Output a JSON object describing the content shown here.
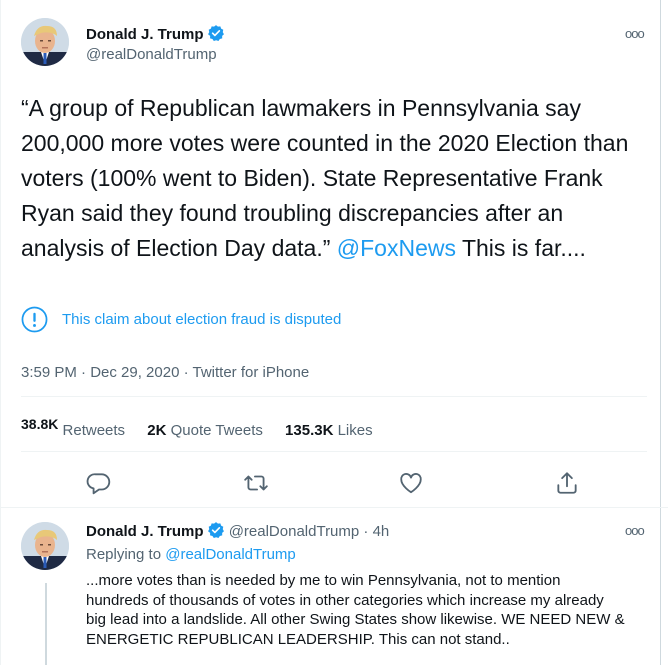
{
  "tweet": {
    "author_name": "Donald J. Trump",
    "author_handle": "@realDonaldTrump",
    "text_before_link": "“A group of Republican lawmakers in Pennsylvania say 200,000 more votes were counted in the 2020 Election than voters (100% went to Biden). State Representative Frank Ryan said they found troubling discrepancies after an analysis of Election Day data.” ",
    "link_text": "@FoxNews",
    "text_after_link": " This is far....",
    "claim_notice": "This claim about election fraud is disputed",
    "timestamp": "3:59 PM · Dec 29, 2020 · Twitter for iPhone",
    "stats": {
      "retweets_count": "38.8K",
      "retweets_label": "Retweets",
      "quote_tweets_count": "2K",
      "quote_tweets_label": "Quote Tweets",
      "likes_count": "135.3K",
      "likes_label": "Likes"
    },
    "actions": [
      "reply-icon",
      "retweet-icon",
      "like-icon",
      "share-icon"
    ]
  },
  "reply": {
    "author_name": "Donald J. Trump",
    "author_handle": "@realDonaldTrump",
    "time_ago": "4h",
    "replying_label": "Replying to",
    "replying_handle": "@realDonaldTrump",
    "text": "...more votes than is needed by me to win Pennsylvania, not to mention hundreds of thousands of votes in other categories which increase my already big lead into a landslide. All other Swing States show likewise. WE NEED NEW & ENERGETIC REPUBLICAN LEADERSHIP. This can not stand.."
  },
  "colors": {
    "accent": "#1d9bf0",
    "text_primary": "#0f1419",
    "text_secondary": "#536471",
    "divider": "#eff3f4"
  }
}
